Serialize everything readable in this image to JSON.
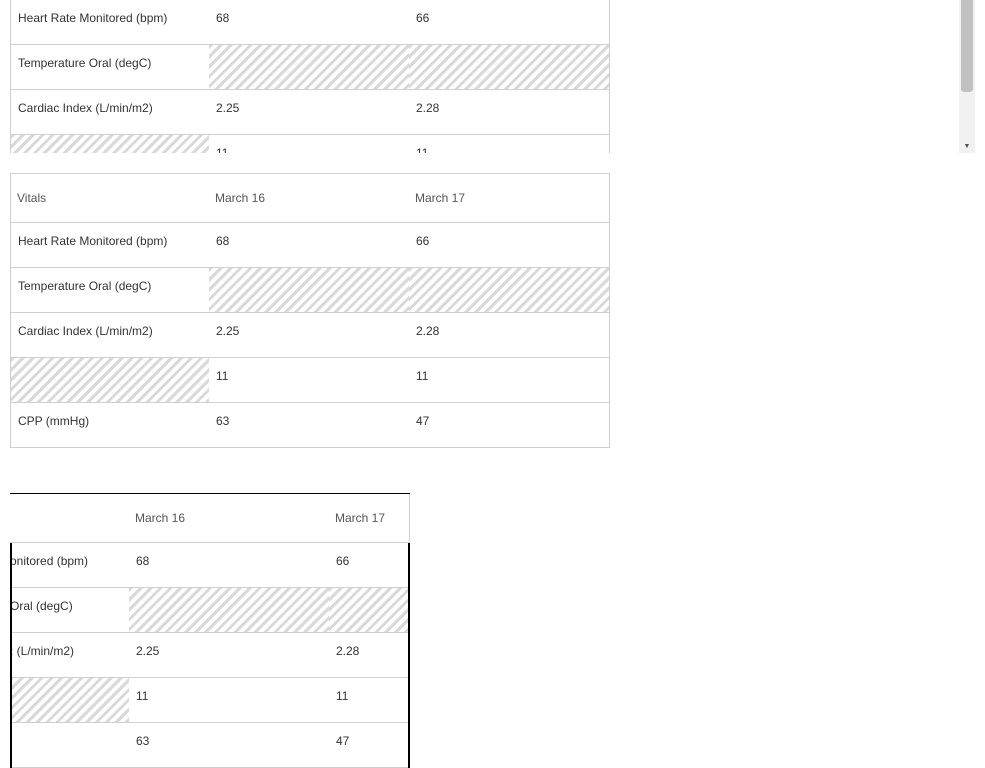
{
  "table": {
    "header": {
      "label": "Vitals",
      "col1": "March 16",
      "col2": "March 17"
    },
    "rows": [
      {
        "label": "Heart Rate Monitored (bpm)",
        "v1": "68",
        "v2": "66"
      },
      {
        "label": "Temperature Oral (degC)",
        "v1": "",
        "v2": ""
      },
      {
        "label": "Cardiac Index (L/min/m2)",
        "v1": "2.25",
        "v2": "2.28"
      },
      {
        "label": "",
        "v1": "11",
        "v2": "11"
      },
      {
        "label": "CPP (mmHg)",
        "v1": "63",
        "v2": "47"
      }
    ]
  },
  "bottom_clipped": {
    "rows": [
      {
        "label": "onitored (bpm)"
      },
      {
        "label": "Oral (degC)"
      },
      {
        "label": ": (L/min/m2)"
      },
      {
        "label": ""
      },
      {
        "label": ""
      }
    ]
  },
  "scrollbar": {
    "down_icon": "▼"
  }
}
